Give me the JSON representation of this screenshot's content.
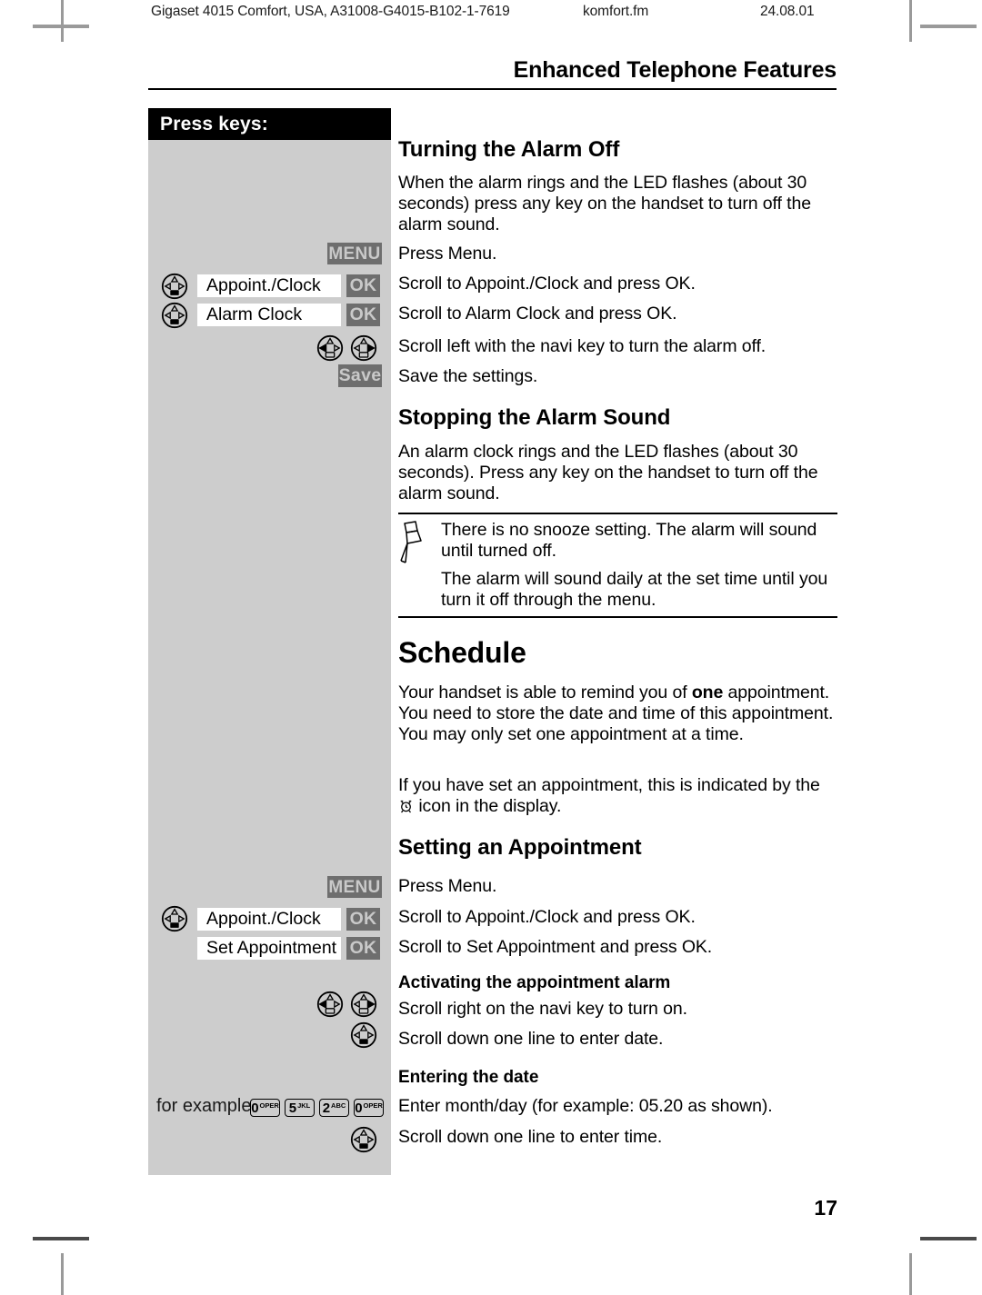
{
  "header": {
    "document_id": "Gigaset 4015 Comfort, USA, A31008-G4015-B102-1-7619",
    "filename": "komfort.fm",
    "date": "24.08.01",
    "chapter_title": "Enhanced Telephone Features"
  },
  "sidebar": {
    "title": "Press keys:",
    "block_one": {
      "menu_label": "MENU",
      "row1": {
        "field": "Appoint./Clock",
        "ok": "OK"
      },
      "row2": {
        "field": "Alarm Clock",
        "ok": "OK"
      },
      "save_label": "Save"
    },
    "block_two": {
      "menu_label": "MENU",
      "row1": {
        "field": "Appoint./Clock",
        "ok": "OK"
      },
      "row2": {
        "field": "Set Appointment",
        "ok": "OK"
      },
      "for_example_label": "for example",
      "keys": [
        {
          "digit": "0",
          "letters": "OPER"
        },
        {
          "digit": "5",
          "letters": "JKL"
        },
        {
          "digit": "2",
          "letters": "ABC"
        },
        {
          "digit": "0",
          "letters": "OPER"
        }
      ]
    }
  },
  "main": {
    "s1_heading": "Turning the Alarm Off",
    "s1_p1": "When the alarm rings and the LED flashes (about 30 seconds) press any key on the handset to turn off the alarm sound.",
    "s1_step1": "Press Menu.",
    "s1_step2": "Scroll to Appoint./Clock and press OK.",
    "s1_step3": "Scroll to Alarm Clock and press OK.",
    "s1_step4": "Scroll left with the navi key to turn the alarm off.",
    "s1_step5": "Save the settings.",
    "s2_heading": "Stopping the Alarm Sound",
    "s2_p1": "An alarm clock rings and the LED flashes (about 30 seconds). Press any key on the handset to turn off the alarm sound.",
    "note1": "There is no snooze setting. The alarm will sound until turned off.",
    "note2": "The alarm will sound daily at the set time until you turn it off through the menu.",
    "s3_heading": "Schedule",
    "s3_p1_a": "Your handset is able to remind you of ",
    "s3_p1_bold": "one",
    "s3_p1_b": " appointment. You need to store the date and time of this appointment. You may only set one appointment at a time.",
    "s3_p2_a": "If you have set an appointment, this is indicated by the ",
    "s3_p2_b": " icon in the display.",
    "s4_heading": "Setting an Appointment",
    "s4_step1": "Press Menu.",
    "s4_step2": "Scroll to Appoint./Clock and press OK.",
    "s4_step3": "Scroll to Set Appointment and press OK.",
    "s4_sub1": "Activating the appointment alarm",
    "s4_step4": "Scroll right on the navi key to turn on.",
    "s4_step5": "Scroll down one line to enter date.",
    "s4_sub2": "Entering the date",
    "s4_step6": "Enter month/day (for example: 05.20 as shown).",
    "s4_step7": "Scroll down one line to enter time."
  },
  "footer": {
    "page_number": "17"
  },
  "colors": {
    "sidebar_bg": "#cdcdcd",
    "softkey_bg": "#6e6e6e",
    "softkey_text": "#c9c9c9",
    "header_bar": "#000000",
    "page_bg": "#ffffff"
  }
}
